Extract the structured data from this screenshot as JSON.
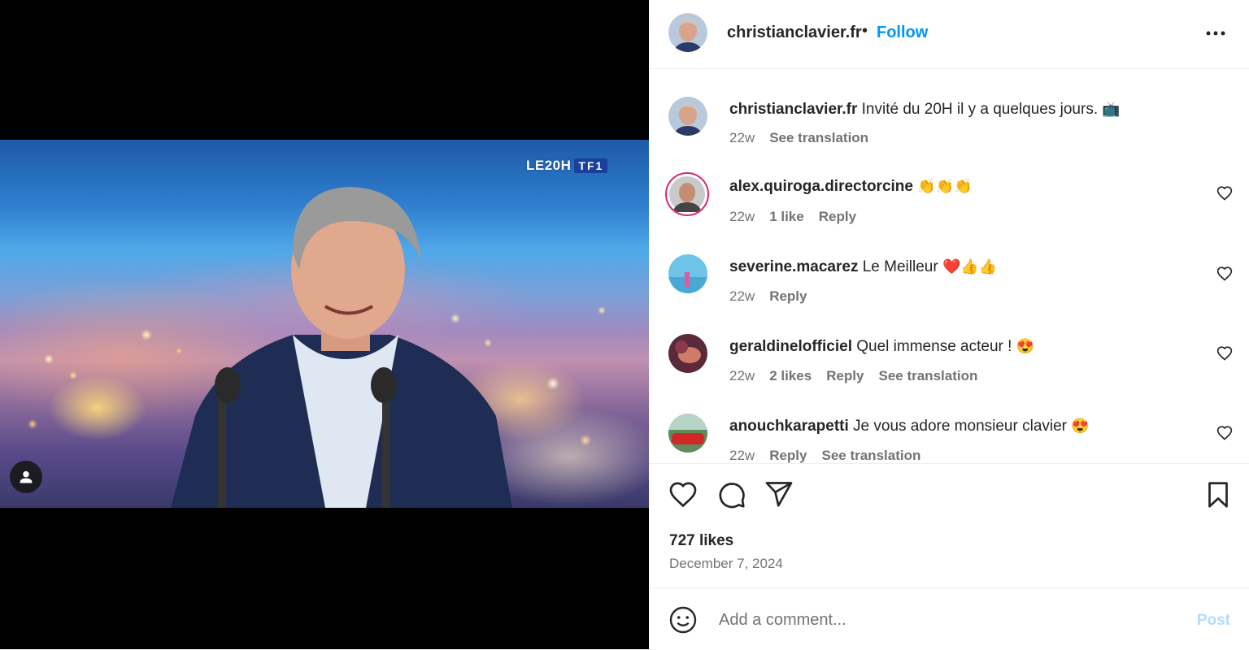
{
  "media": {
    "tv_logo_prefix": "LE20H",
    "tv_logo_brand": "TF1"
  },
  "header": {
    "username": "christianclavier.fr",
    "separator": "•",
    "follow_label": "Follow"
  },
  "caption": {
    "username": "christianclavier.fr",
    "text": "Invité du 20H il y a quelques jours.",
    "emoji": "📺",
    "age": "22w",
    "see_translation": "See translation"
  },
  "comments": [
    {
      "username": "alex.quiroga.directorcine",
      "text": "",
      "emoji": "👏👏👏",
      "age": "22w",
      "likes": "1 like",
      "reply": "Reply",
      "see_translation": ""
    },
    {
      "username": "severine.macarez",
      "text": "Le Meilleur",
      "emoji": "❤️👍👍",
      "age": "22w",
      "likes": "",
      "reply": "Reply",
      "see_translation": ""
    },
    {
      "username": "geraldinelofficiel",
      "text": "Quel immense acteur !",
      "emoji": "😍",
      "age": "22w",
      "likes": "2 likes",
      "reply": "Reply",
      "see_translation": "See translation"
    },
    {
      "username": "anouchkarapetti",
      "text": "Je vous adore monsieur clavier",
      "emoji": "😍",
      "age": "22w",
      "likes": "",
      "reply": "Reply",
      "see_translation": "See translation"
    }
  ],
  "stats": {
    "likes": "727 likes",
    "date": "December 7, 2024"
  },
  "add_comment": {
    "placeholder": "Add a comment...",
    "post_label": "Post"
  },
  "colors": {
    "accent": "#0095f6",
    "post_disabled": "#b3dbff",
    "muted": "#737373"
  }
}
